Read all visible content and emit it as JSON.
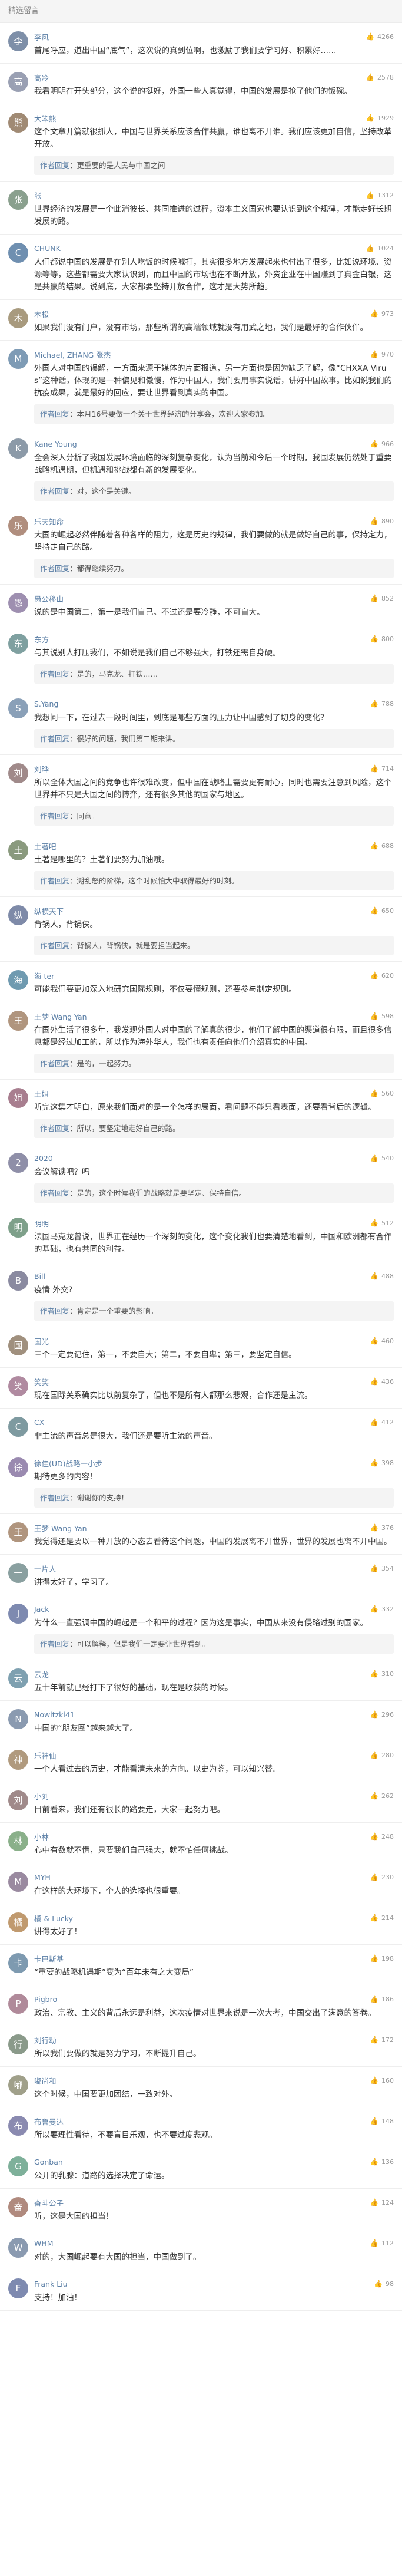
{
  "section": {
    "title": "精选留言"
  },
  "comments": [
    {
      "name": "李风",
      "likes": "4266",
      "text": "首尾呼应，道出中国“底气”，这次说的真到位啊，也激励了我们要学习好、积累好……",
      "avatar_char": "李",
      "avatar_color": "#7e8fa8"
    },
    {
      "name": "高冷",
      "likes": "2578",
      "text": "我看明明在开头部分，这个说的挺好，外国一些人真觉得，中国的发展是抢了他们的饭碗。",
      "avatar_char": "高",
      "avatar_color": "#9aa0b3"
    },
    {
      "name": "大笨熊",
      "likes": "1929",
      "text": "这个文章开篇就很抓人，中国与世界关系应该合作共赢，谁也离不开谁。我们应该更加自信，坚持改革开放。",
      "avatar_char": "熊",
      "avatar_color": "#a08a74",
      "reply": {
        "author": "作者回复",
        "text": "更重要的是人民与中国之间"
      }
    },
    {
      "name": "张",
      "likes": "1312",
      "text": "世界经济的发展是一个此消彼长、共同推进的过程，资本主义国家也要认识到这个规律，才能走好长期发展的路。",
      "avatar_char": "张",
      "avatar_color": "#8aa08e"
    },
    {
      "name": "CHUNK",
      "likes": "1024",
      "text": "人们都说中国的发展是在别人吃饭的时候喊打，其实很多地方发展起来也付出了很多，比如说环境、资源等等，这些都需要大家认识到，而且中国的市场也在不断开放，外资企业在中国赚到了真金白银，这是共赢的结果。说到底，大家都要坚持开放合作，这才是大势所趋。",
      "avatar_char": "C",
      "avatar_color": "#6f8fb0"
    },
    {
      "name": "木松",
      "likes": "973",
      "text": "如果我们没有门户，没有市场，那些所谓的高端领域就没有用武之地，我们是最好的合作伙伴。",
      "avatar_char": "木",
      "avatar_color": "#a89a7e"
    },
    {
      "name": "Michael, ZHANG 张杰",
      "likes": "970",
      "text": "外国人对中国的误解，一方面来源于媒体的片面报道，另一方面也是因为缺乏了解，像“CHXXA Virus”这种话，体现的是一种偏见和傲慢，作为中国人，我们要用事实说话，讲好中国故事。比如说我们的抗疫成果，就是最好的回应，要让世界看到真实的中国。",
      "avatar_char": "M",
      "avatar_color": "#7e9bb5",
      "reply": {
        "author": "作者回复",
        "text": "本月16号要做一个关于世界经济的分享会，欢迎大家参加。"
      }
    },
    {
      "name": "Kane Young",
      "likes": "966",
      "text": "全会深入分析了我国发展环境面临的深刻复杂变化，认为当前和今后一个时期，我国发展仍然处于重要战略机遇期，但机遇和挑战都有新的发展变化。",
      "avatar_char": "K",
      "avatar_color": "#8c9aa8",
      "reply": {
        "author": "作者回复",
        "text": "对，这个是关键。"
      }
    },
    {
      "name": "乐天知命",
      "likes": "890",
      "text": "大国的崛起必然伴随着各种各样的阻力，这是历史的规律，我们要做的就是做好自己的事，保持定力，坚持走自己的路。",
      "avatar_char": "乐",
      "avatar_color": "#b08e7e",
      "reply": {
        "author": "作者回复",
        "text": "都得继续努力。"
      }
    },
    {
      "name": "愚公移山",
      "likes": "852",
      "text": "说的是中国第二，第一是我们自己。不过还是要冷静，不可自大。",
      "avatar_char": "愚",
      "avatar_color": "#9e8fb0"
    },
    {
      "name": "东方",
      "likes": "800",
      "text": "与其说别人打压我们，不如说是我们自己不够强大，打铁还需自身硬。",
      "avatar_char": "东",
      "avatar_color": "#7fa0a0",
      "reply": {
        "author": "作者回复",
        "text": "是的，马克龙、打铁……"
      }
    },
    {
      "name": "S.Yang",
      "likes": "788",
      "text": "我想问一下，在过去一段时间里，到底是哪些方面的压力让中国感到了切身的变化？",
      "avatar_char": "S",
      "avatar_color": "#8aa0b8",
      "reply": {
        "author": "作者回复",
        "text": "很好的问题，我们第二期来讲。"
      }
    },
    {
      "name": "刘晔",
      "likes": "714",
      "text": "所以全体大国之间的竞争也许很难改变，但中国在战略上需要更有耐心，同时也需要注意到风险，这个世界并不只是大国之间的博弈，还有很多其他的国家与地区。",
      "avatar_char": "刘",
      "avatar_color": "#a08a8a",
      "reply": {
        "author": "作者回复",
        "text": "同意。"
      }
    },
    {
      "name": "土著吧",
      "likes": "688",
      "text": "土著是哪里的？土著们要努力加油哦。",
      "avatar_char": "土",
      "avatar_color": "#8a9a7e",
      "reply": {
        "author": "作者回复",
        "text": "溯乱怒的阶梯，这个时候怕大中取得最好的时刻。"
      }
    },
    {
      "name": "纵横天下",
      "likes": "650",
      "text": "背锅人，背锅侠。",
      "avatar_char": "纵",
      "avatar_color": "#7e8aa8",
      "reply": {
        "author": "作者回复",
        "text": "背锅人，背锅侠，就是要担当起来。"
      }
    },
    {
      "name": "海 ter",
      "likes": "620",
      "text": "可能我们要更加深入地研究国际规则，不仅要懂规则，还要参与制定规则。",
      "avatar_char": "海",
      "avatar_color": "#6f9ab0"
    },
    {
      "name": "王梦 Wang Yan",
      "likes": "598",
      "text": "在国外生活了很多年，我发现外国人对中国的了解真的很少，他们了解中国的渠道很有限，而且很多信息都是经过加工的，所以作为海外华人，我们也有责任向他们介绍真实的中国。",
      "avatar_char": "王",
      "avatar_color": "#b0957e",
      "reply": {
        "author": "作者回复",
        "text": "是的，一起努力。"
      }
    },
    {
      "name": "王姐",
      "likes": "560",
      "text": "听完这集才明白，原来我们面对的是一个怎样的局面，看问题不能只看表面，还要看背后的逻辑。",
      "avatar_char": "姐",
      "avatar_color": "#a87e8f",
      "reply": {
        "author": "作者回复",
        "text": "所以，要坚定地走好自己的路。"
      }
    },
    {
      "name": "2020",
      "likes": "540",
      "text": "会议解读吧？吗",
      "avatar_char": "2",
      "avatar_color": "#8f8fa8",
      "reply": {
        "author": "作者回复",
        "text": "是的，这个时候我们的战略就是要坚定、保持自信。"
      }
    },
    {
      "name": "明明",
      "likes": "512",
      "text": "法国马克龙曾说，世界正在经历一个深刻的变化，这个变化我们也要清楚地看到，中国和欧洲都有合作的基础，也有共同的利益。",
      "avatar_char": "明",
      "avatar_color": "#7ea08a"
    },
    {
      "name": "Bill",
      "likes": "488",
      "text": "疫情 外交？",
      "avatar_char": "B",
      "avatar_color": "#8a8aa0",
      "reply": {
        "author": "作者回复",
        "text": "肯定是一个重要的影响。"
      }
    },
    {
      "name": "国光",
      "likes": "460",
      "text": "三个一定要记住，第一，不要自大；第二，不要自卑；第三，要坚定自信。",
      "avatar_char": "国",
      "avatar_color": "#a0907e"
    },
    {
      "name": "笑笑",
      "likes": "436",
      "text": "现在国际关系确实比以前复杂了，但也不是所有人都那么悲观，合作还是主流。",
      "avatar_char": "笑",
      "avatar_color": "#b08aa0"
    },
    {
      "name": "CX",
      "likes": "412",
      "text": "非主流的声音总是很大，我们还是要听主流的声音。",
      "avatar_char": "C",
      "avatar_color": "#7e9aa0"
    },
    {
      "name": "徐佳(UD)战略一小步",
      "likes": "398",
      "text": "期待更多的内容！",
      "avatar_char": "徐",
      "avatar_color": "#9a8ab0",
      "reply": {
        "author": "作者回复",
        "text": "谢谢你的支持！"
      }
    },
    {
      "name": "王梦 Wang Yan",
      "likes": "376",
      "text": "我觉得还是要以一种开放的心态去看待这个问题，中国的发展离不开世界，世界的发展也离不开中国。",
      "avatar_char": "王",
      "avatar_color": "#b0957e"
    },
    {
      "name": "一片人",
      "likes": "354",
      "text": "讲得太好了，学习了。",
      "avatar_char": "一",
      "avatar_color": "#8aa0a0"
    },
    {
      "name": "Jack",
      "likes": "332",
      "text": "为什么一直强调中国的崛起是一个和平的过程？因为这是事实，中国从来没有侵略过别的国家。",
      "avatar_char": "J",
      "avatar_color": "#7e8ab0",
      "reply": {
        "author": "作者回复",
        "text": "可以解释，但是我们一定要让世界看到。"
      }
    },
    {
      "name": "云龙",
      "likes": "310",
      "text": "五十年前就已经打下了很好的基础，现在是收获的时候。",
      "avatar_char": "云",
      "avatar_color": "#7ea0b0"
    },
    {
      "name": "Nowitzki41",
      "likes": "296",
      "text": "中国的“朋友圈”越来越大了。",
      "avatar_char": "N",
      "avatar_color": "#8a9ab0"
    },
    {
      "name": "乐神仙",
      "likes": "280",
      "text": "一个人看过去的历史，才能看清未来的方向。以史为鉴，可以知兴替。",
      "avatar_char": "神",
      "avatar_color": "#b09a7e"
    },
    {
      "name": "小刘",
      "likes": "262",
      "text": "目前看来，我们还有很长的路要走，大家一起努力吧。",
      "avatar_char": "刘",
      "avatar_color": "#a08a8a"
    },
    {
      "name": "小林",
      "likes": "248",
      "text": "心中有数就不慌，只要我们自己强大，就不怕任何挑战。",
      "avatar_char": "林",
      "avatar_color": "#8ab08a"
    },
    {
      "name": "MYH",
      "likes": "230",
      "text": "在这样的大环境下，个人的选择也很重要。",
      "avatar_char": "M",
      "avatar_color": "#9a8aa0"
    },
    {
      "name": "橘 & Lucky",
      "likes": "214",
      "text": "讲得太好了！",
      "avatar_char": "橘",
      "avatar_color": "#c09a6f"
    },
    {
      "name": "卡巴斯基",
      "likes": "198",
      "text": "“重要的战略机遇期”变为“百年未有之大变局”",
      "avatar_char": "卡",
      "avatar_color": "#7e9ab0"
    },
    {
      "name": "Pigbro",
      "likes": "186",
      "text": "政治、宗教、主义的背后永远是利益，这次疫情对世界来说是一次大考，中国交出了满意的答卷。",
      "avatar_char": "P",
      "avatar_color": "#b08a9a"
    },
    {
      "name": "刘行动",
      "likes": "172",
      "text": "所以我们要做的就是努力学习，不断提升自己。",
      "avatar_char": "行",
      "avatar_color": "#8a9a8a"
    },
    {
      "name": "嘟尚和",
      "likes": "160",
      "text": "这个时候，中国要更加团结，一致对外。",
      "avatar_char": "嘟",
      "avatar_color": "#a0a08a"
    },
    {
      "name": "布鲁曼达",
      "likes": "148",
      "text": "所以要理性看待，不要盲目乐观，也不要过度悲观。",
      "avatar_char": "布",
      "avatar_color": "#8a8ab0"
    },
    {
      "name": "Gonban",
      "likes": "136",
      "text": "公开的乳腺：道路的选择决定了命运。",
      "avatar_char": "G",
      "avatar_color": "#7eb09a"
    },
    {
      "name": "奋斗公子",
      "likes": "124",
      "text": "听，这是大国的担当！",
      "avatar_char": "奋",
      "avatar_color": "#b08a7e"
    },
    {
      "name": "WHM",
      "likes": "112",
      "text": "对的，大国崛起要有大国的担当，中国做到了。",
      "avatar_char": "W",
      "avatar_color": "#8a9ab0"
    },
    {
      "name": "Frank Liu",
      "likes": "98",
      "text": "支持！加油！",
      "avatar_char": "F",
      "avatar_color": "#7e8ab0"
    }
  ]
}
